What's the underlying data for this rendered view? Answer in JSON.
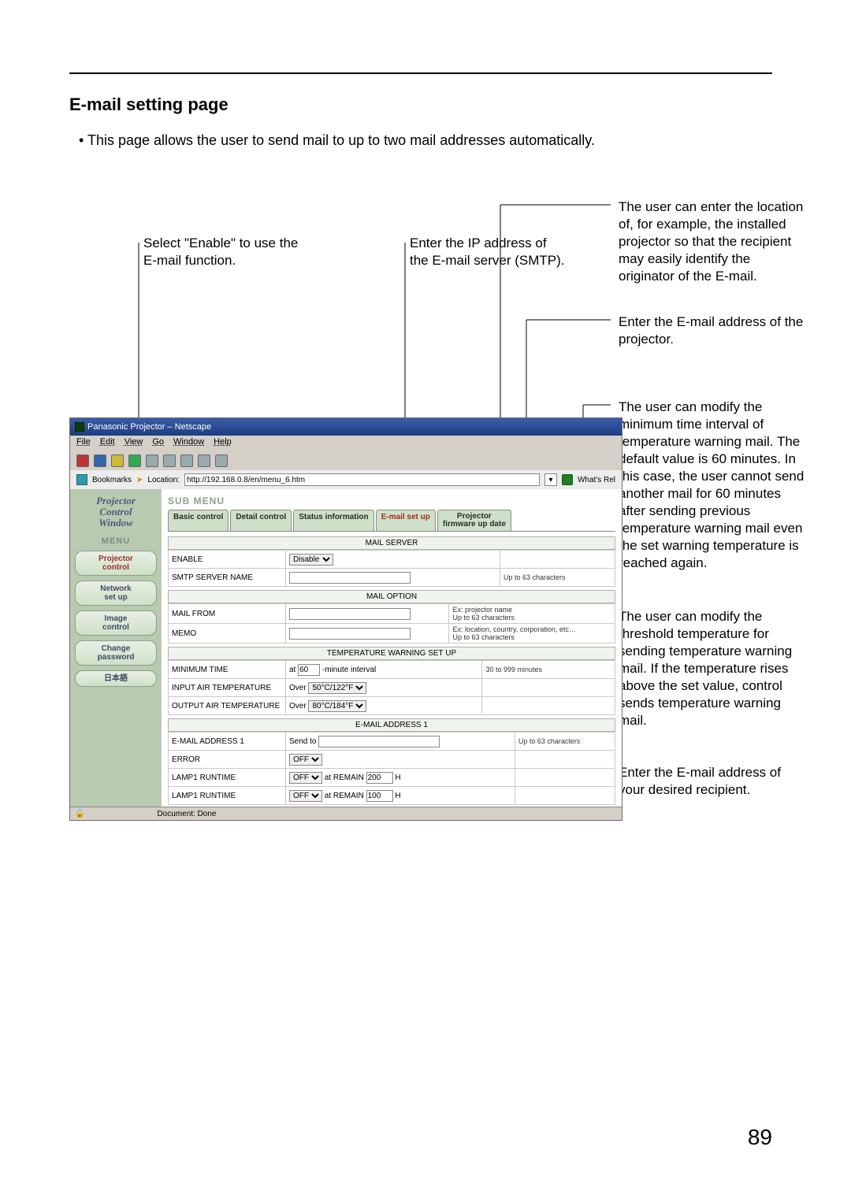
{
  "page": {
    "heading": "E-mail setting page",
    "intro_bullet": "• This page allows the user to send mail to up to two mail addresses automatically.",
    "number": "89"
  },
  "callouts": {
    "enable": "Select \"Enable\" to use the E-mail function.",
    "smtp": "Enter the IP address of the E-mail server (SMTP).",
    "location": "The user can enter the location of, for example, the installed projector so that the recipient may easily identify the originator of the E-mail.",
    "mailfrom": "Enter the E-mail address of the projector.",
    "mintime": "The user can modify the minimum time interval of temperature warning mail. The default value is 60 minutes.  In this case, the user cannot send another mail for 60 minutes after sending previous temperature warning mail even the set warning temperature is reached again.",
    "threshold": "The user can modify the threshold temperature for sending temperature warning mail. If the temperature rises above the set value, control sends temperature warning mail.",
    "recipient": "Enter the E-mail address of your desired recipient."
  },
  "window": {
    "title": "Panasonic Projector – Netscape",
    "menu": [
      "File",
      "Edit",
      "View",
      "Go",
      "Window",
      "Help"
    ],
    "bookmarks_label": "Bookmarks",
    "location_label": "Location:",
    "location_value": "http://192.168.0.8/en/menu_6.htm",
    "whats_related": "What's Rel",
    "status": "Document: Done"
  },
  "sidebar": {
    "title_line1": "Projector",
    "title_line2": "Control",
    "title_line3": "Window",
    "menu_label": "MENU",
    "buttons": {
      "projector_control": "Projector\ncontrol",
      "network_setup": "Network\nset up",
      "image_control": "Image\ncontrol",
      "change_password": "Change\npassword",
      "japanese": "日本語"
    }
  },
  "main": {
    "submenu_label": "SUB MENU",
    "tabs": {
      "basic": "Basic control",
      "detail": "Detail control",
      "status": "Status information",
      "email": "E-mail set up",
      "firmware": "Projector\nfirmware up date"
    },
    "sections": {
      "mail_server": "MAIL SERVER",
      "mail_option": "MAIL OPTION",
      "temp_setup": "TEMPERATURE WARNING SET UP",
      "email_addr1": "E-MAIL ADDRESS 1"
    },
    "rows": {
      "enable": {
        "label": "ENABLE",
        "value": "Disable"
      },
      "smtp_name": {
        "label": "SMTP SERVER NAME",
        "hint": "Up to 63 characters"
      },
      "mail_from": {
        "label": "MAIL FROM",
        "hint": "Ex: projector name\nUp to 63 characters"
      },
      "memo": {
        "label": "MEMO",
        "hint": "Ex: location, country, corporation, etc…\nUp to 63 characters"
      },
      "min_time": {
        "label": "MINIMUM TIME",
        "prefix": "at",
        "value": "60",
        "suffix": "-minute interval",
        "hint": "30 to 999 minutes"
      },
      "input_temp": {
        "label": "INPUT AIR TEMPERATURE",
        "prefix": "Over",
        "value": "50°C/122°F"
      },
      "output_temp": {
        "label": "OUTPUT AIR TEMPERATURE",
        "prefix": "Over",
        "value": "80°C/184°F"
      },
      "email1": {
        "label": "E-MAIL ADDRESS 1",
        "sendto": "Send to",
        "hint": "Up to 63 characters"
      },
      "error": {
        "label": "ERROR",
        "value": "OFF"
      },
      "lamp1a": {
        "label": "LAMP1 RUNTIME",
        "value": "OFF",
        "at": "at REMAIN",
        "num": "200",
        "h": "H"
      },
      "lamp1b": {
        "label": "LAMP1 RUNTIME",
        "value": "OFF",
        "at": "at REMAIN",
        "num": "100",
        "h": "H"
      }
    }
  }
}
